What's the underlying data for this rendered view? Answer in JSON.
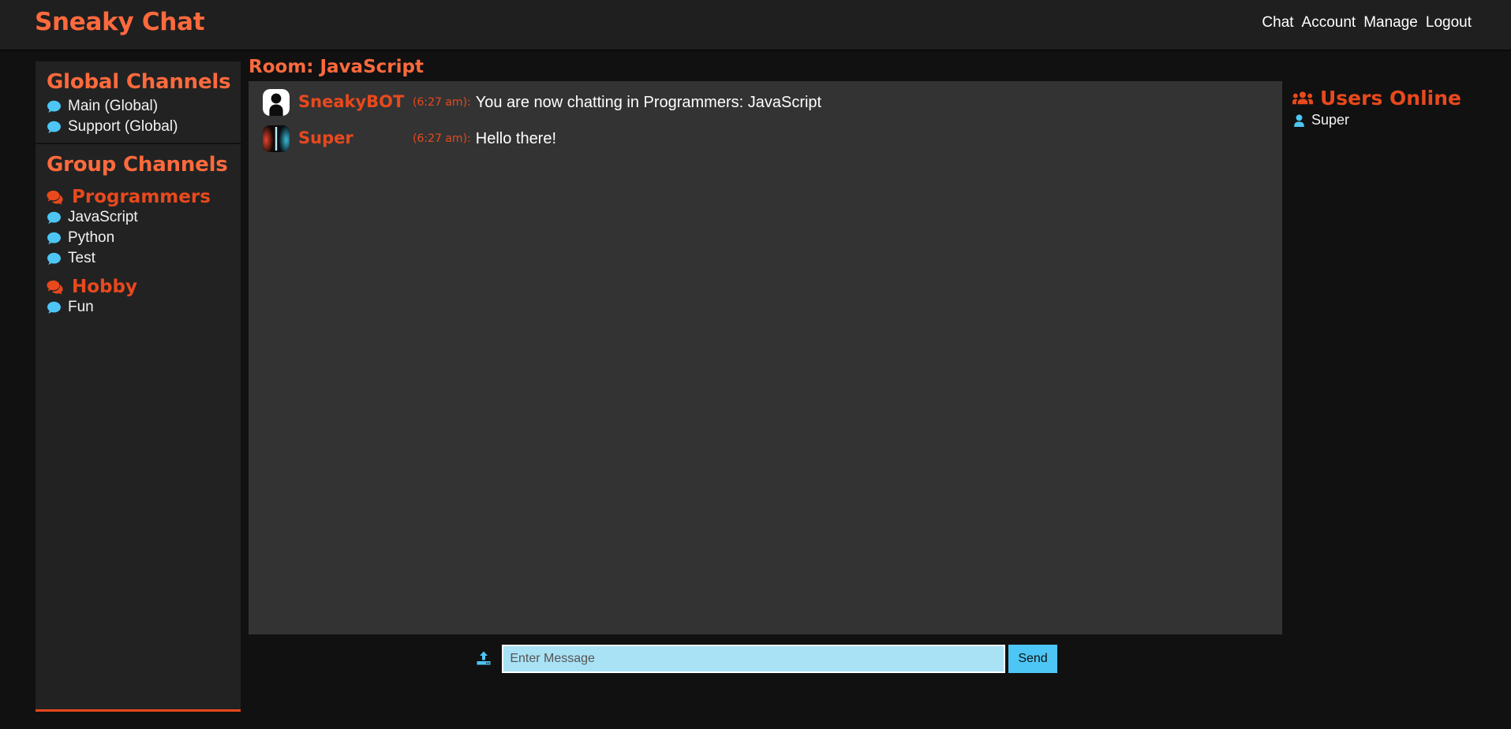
{
  "header": {
    "brand": "Sneaky Chat",
    "nav": [
      {
        "label": "Chat"
      },
      {
        "label": "Account"
      },
      {
        "label": "Manage"
      },
      {
        "label": "Logout"
      }
    ]
  },
  "sidebar": {
    "global": {
      "title": "Global Channels",
      "channels": [
        {
          "label": "Main (Global)",
          "icon": "comment-icon"
        },
        {
          "label": "Support (Global)",
          "icon": "comment-icon"
        }
      ]
    },
    "groups": {
      "title": "Group Channels",
      "items": [
        {
          "name": "Programmers",
          "icon": "comments-icon",
          "channels": [
            {
              "label": "JavaScript",
              "icon": "comment-icon"
            },
            {
              "label": "Python",
              "icon": "comment-icon"
            },
            {
              "label": "Test",
              "icon": "comment-icon"
            }
          ]
        },
        {
          "name": "Hobby",
          "icon": "comments-icon",
          "channels": [
            {
              "label": "Fun",
              "icon": "comment-icon"
            }
          ]
        }
      ]
    }
  },
  "main": {
    "room_title": "Room: JavaScript",
    "messages": [
      {
        "user": "SneakyBOT",
        "time": "(6:27 am):",
        "text": "You are now chatting in Programmers: JavaScript",
        "avatar": "default-silhouette-avatar"
      },
      {
        "user": "Super",
        "time": "(6:27 am):",
        "text": "Hello there!",
        "avatar": "lightsaber-duel-avatar"
      }
    ]
  },
  "users_online": {
    "title": "Users Online",
    "icon": "users-group-icon",
    "users": [
      {
        "name": "Super",
        "icon": "user-icon"
      }
    ]
  },
  "input_bar": {
    "upload_icon": "upload-icon",
    "message_value": "",
    "placeholder": "Enter Message",
    "send_label": "Send"
  },
  "colors": {
    "brand": "#ff6a3d",
    "accent": "#e8491d",
    "channel_icon": "#4dc6f5",
    "input_bg": "#a9e2f5",
    "send_bg": "#4dc6f5",
    "page_bg": "#111111",
    "panel_bg": "#333333",
    "sidebar_bg": "#222222"
  }
}
